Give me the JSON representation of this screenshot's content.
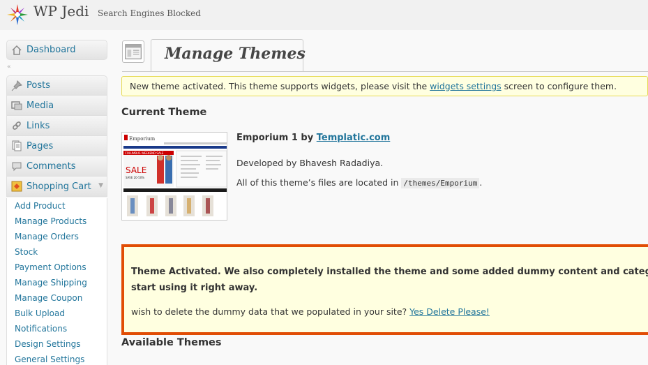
{
  "header": {
    "site_title": "WP Jedi",
    "site_status": "Search Engines Blocked"
  },
  "sidebar": {
    "dashboard": "Dashboard",
    "items": [
      {
        "label": "Posts",
        "icon": "pin-icon"
      },
      {
        "label": "Media",
        "icon": "media-icon"
      },
      {
        "label": "Links",
        "icon": "link-icon"
      },
      {
        "label": "Pages",
        "icon": "pages-icon"
      },
      {
        "label": "Comments",
        "icon": "comment-icon"
      },
      {
        "label": "Shopping Cart",
        "icon": "cart-icon"
      }
    ],
    "submenu": [
      "Add Product",
      "Manage Products",
      "Manage Orders",
      "Stock",
      "Payment Options",
      "Manage Shipping",
      "Manage Coupon",
      "Bulk Upload",
      "Notifications",
      "Design Settings",
      "General Settings"
    ]
  },
  "main": {
    "page_title": "Manage Themes",
    "notice": {
      "before": "New theme activated. This theme supports widgets, please visit the ",
      "link": "widgets settings",
      "after": " screen to configure them."
    },
    "current_theme_heading": "Current Theme",
    "theme": {
      "name": "Emporium 1",
      "by": " by ",
      "author_link": "Templatic.com",
      "developed_by": "Developed by Bhavesh Radadiya.",
      "files_prefix": "All of this theme’s files are located in ",
      "files_path": "/themes/Emporium",
      "files_suffix": ".",
      "thumb_logo": "Emporium",
      "thumb_sale": "SALE",
      "thumb_save": "SAVE 20-50%",
      "thumb_banner": "COLUMBUS WEEKEND SALE"
    },
    "activation": {
      "line1": "Theme Activated. We also completely installed the theme and some added dummy content and categories",
      "line2": "start using it right away.",
      "line3_text": "wish to delete the dummy data that we populated in your site? ",
      "line3_link": "Yes Delete Please!"
    },
    "available_themes_heading": "Available Themes"
  },
  "colors": {
    "link": "#21759b",
    "notice_bg": "#ffffe0",
    "notice_border": "#e6db55",
    "activation_border": "#e14d05"
  }
}
